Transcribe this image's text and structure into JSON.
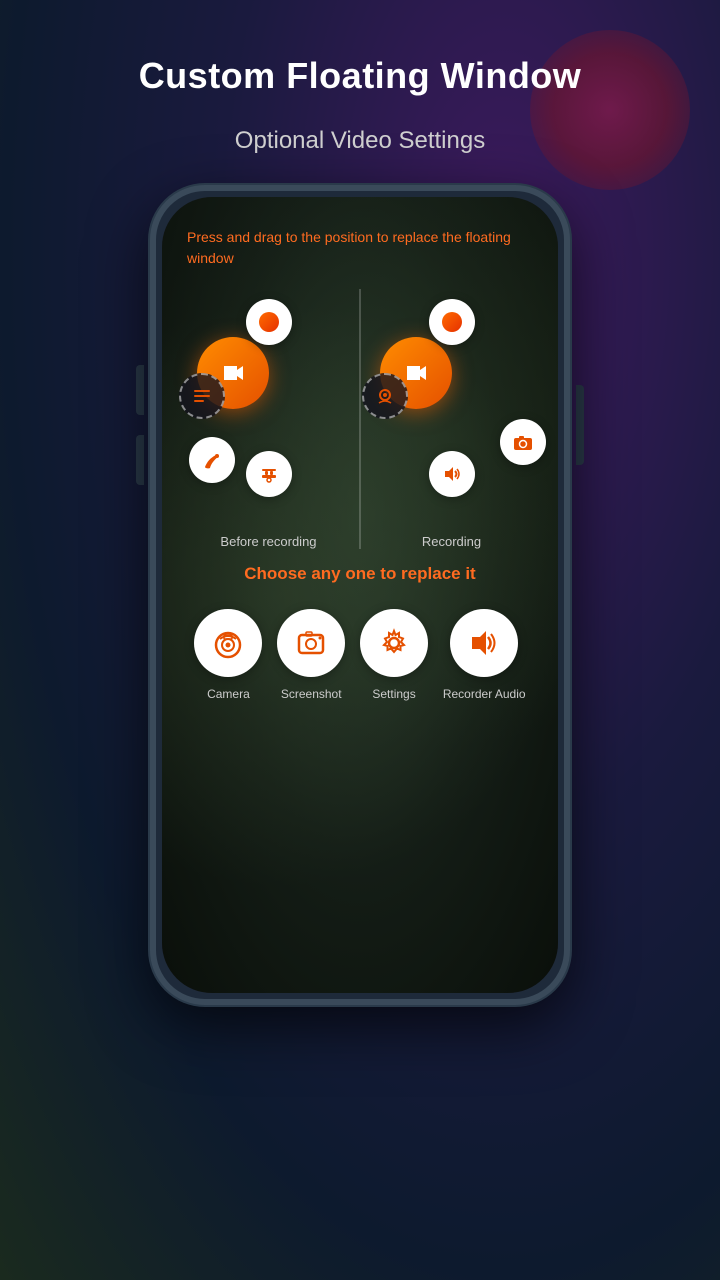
{
  "page": {
    "title": "Custom Floating Window",
    "subtitle": "Optional Video Settings"
  },
  "phone": {
    "press_drag_text": "Press and drag to the position to replace the floating window",
    "before_recording_label": "Before recording",
    "recording_label": "Recording",
    "choose_text": "Choose any one to replace it"
  },
  "bottom_icons": [
    {
      "id": "camera",
      "label": "Camera"
    },
    {
      "id": "screenshot",
      "label": "Screenshot"
    },
    {
      "id": "settings",
      "label": "Settings"
    },
    {
      "id": "recorder-audio",
      "label": "Recorder\nAudio"
    }
  ]
}
